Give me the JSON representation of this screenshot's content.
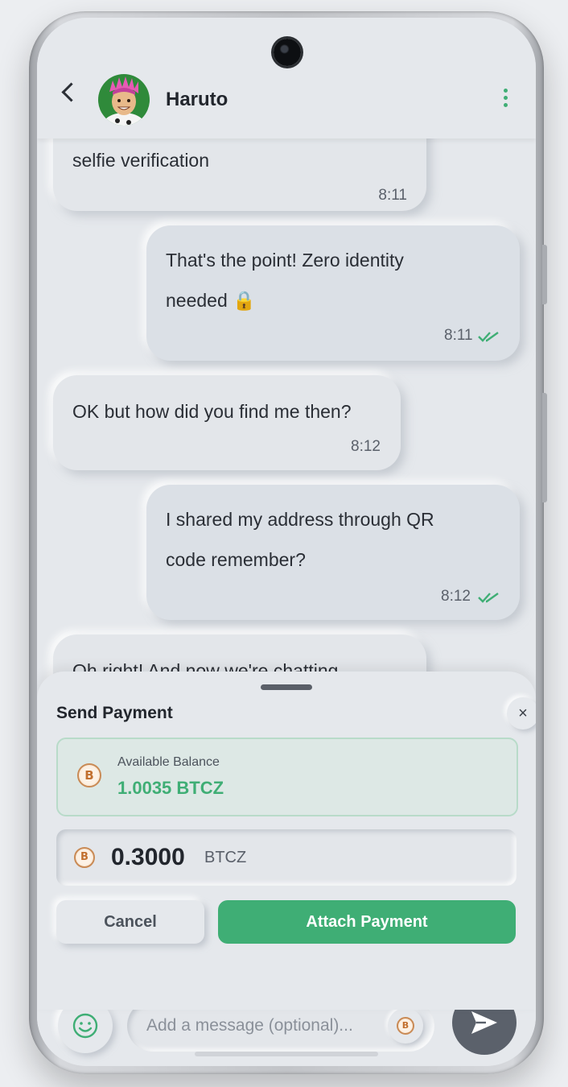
{
  "header": {
    "contact_name": "Haruto",
    "back_icon": "chevron-left-icon",
    "menu_icon": "kebab-menu-icon"
  },
  "messages": [
    {
      "direction": "in",
      "text": "selfie verification",
      "time": "8:11"
    },
    {
      "direction": "out",
      "text": "That's the point! Zero identity",
      "text2": "needed 🔒",
      "time": "8:11",
      "read": true
    },
    {
      "direction": "in",
      "text": "OK but how did you find me then?",
      "time": "8:12"
    },
    {
      "direction": "out",
      "text": "I shared my address through QR",
      "text2": "code remember?",
      "time": "8:12",
      "read": true
    },
    {
      "direction": "in",
      "text": "Oh right! And now we're chatting"
    }
  ],
  "payment_sheet": {
    "title": "Send Payment",
    "close_glyph": "×",
    "balance_label": "Available Balance",
    "balance_value": "1.0035 BTCZ",
    "amount_value": "0.3000",
    "amount_unit": "BTCZ",
    "cancel_label": "Cancel",
    "attach_label": "Attach Payment"
  },
  "composer": {
    "placeholder": "Add a message (optional)...",
    "emoji_icon": "smiley-icon",
    "send_icon": "send-icon"
  },
  "colors": {
    "accent": "#3fae75",
    "background": "#e5e8ec",
    "send_button": "#5b616b"
  }
}
